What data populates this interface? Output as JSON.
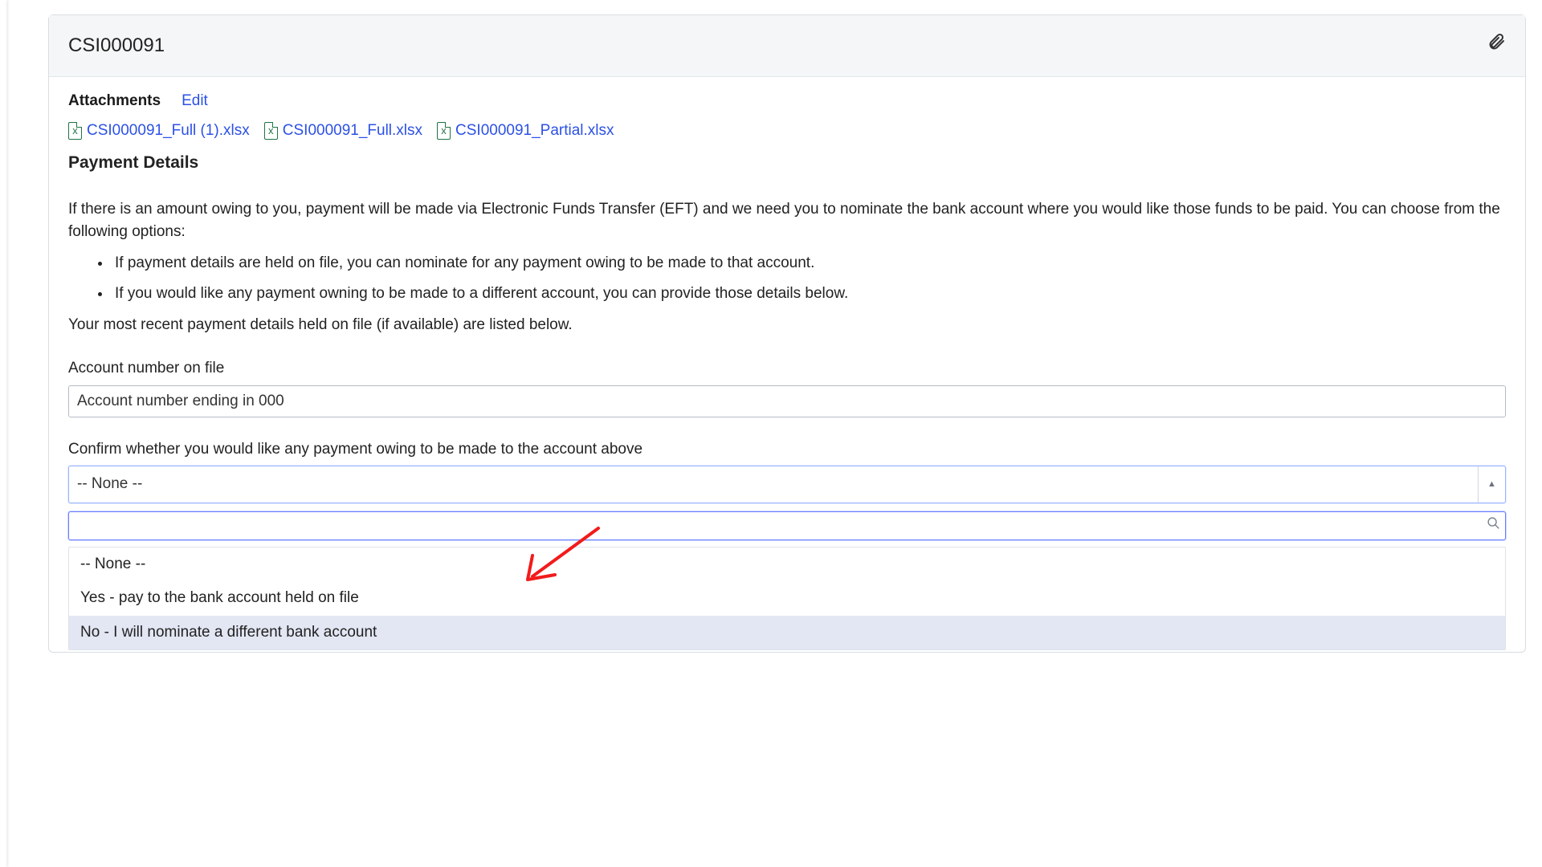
{
  "header": {
    "title": "CSI000091"
  },
  "attachments": {
    "label": "Attachments",
    "edit_label": "Edit",
    "files": [
      "CSI000091_Full (1).xlsx",
      "CSI000091_Full.xlsx",
      "CSI000091_Partial.xlsx"
    ]
  },
  "section": {
    "heading": "Payment Details",
    "intro": "If there is an amount owing to you, payment will be made via Electronic Funds Transfer (EFT) and we need you to nominate the bank account where you would like those funds to be paid. You can choose from the following options:",
    "bullets": [
      "If payment details are held on file, you can nominate for any payment owing to be made to that account.",
      "If you would like any payment owning to be made to a different account, you can provide those details below."
    ],
    "footnote": "Your most recent payment details held on file (if available) are listed below."
  },
  "fields": {
    "account_on_file": {
      "label": "Account number on file",
      "value": "Account number ending in 000"
    },
    "confirm": {
      "label": "Confirm whether you would like any payment owing to be made to the account above",
      "selected": "-- None --",
      "search_placeholder": "",
      "options": [
        "-- None --",
        "Yes - pay to the bank account held on file",
        "No - I will nominate a different bank account"
      ],
      "highlighted_index": 2
    }
  }
}
